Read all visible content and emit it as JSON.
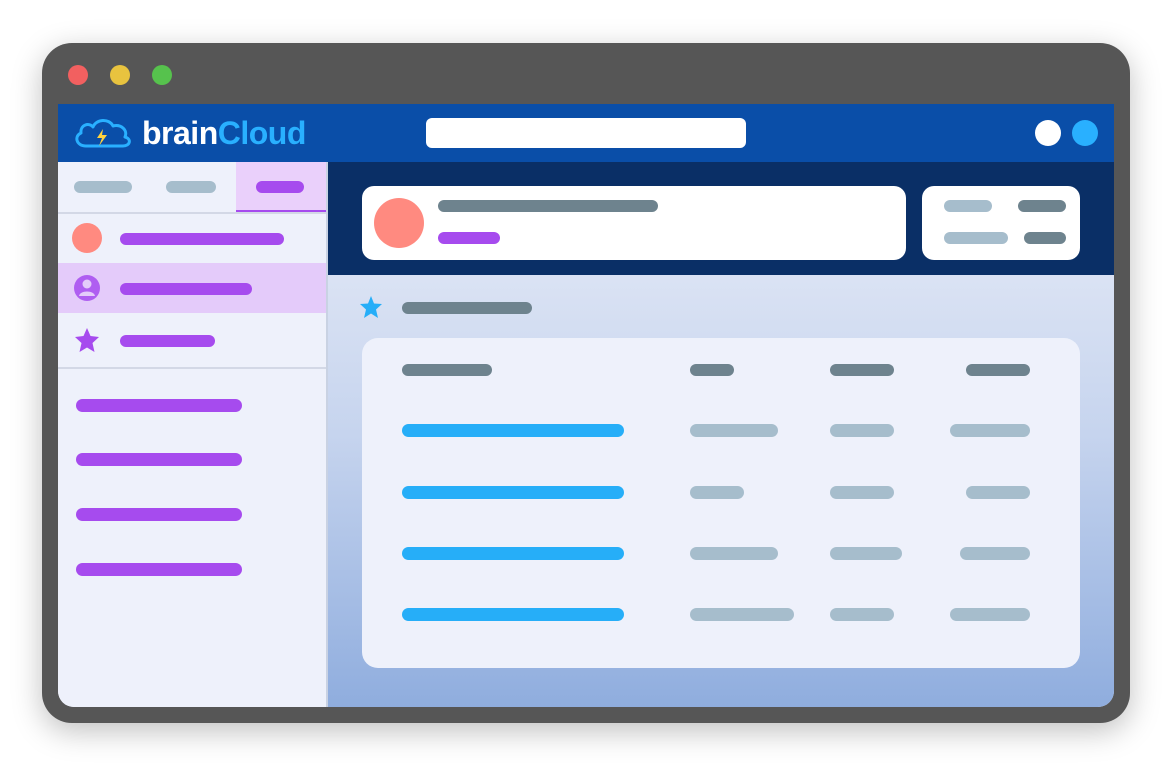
{
  "window": {
    "controls": [
      "close",
      "minimize",
      "maximize"
    ]
  },
  "app": {
    "brand": "brainCloud",
    "logo_icon": "cloud-lightning-icon"
  },
  "topbar": {
    "search_value": "",
    "actions": [
      "white-circle",
      "blue-circle"
    ]
  },
  "sidebar": {
    "tabs": [
      {
        "id": "tab-1",
        "active": false
      },
      {
        "id": "tab-2",
        "active": false
      },
      {
        "id": "tab-3",
        "active": true
      }
    ],
    "items": [
      {
        "icon": "avatar-dot-icon",
        "active": false
      },
      {
        "icon": "user-icon",
        "active": true
      },
      {
        "icon": "star-icon",
        "active": false
      }
    ],
    "links_count_visible": 4
  },
  "main": {
    "section_icon": "star-icon",
    "table": {
      "columns": 4,
      "rows": 4
    }
  },
  "colors": {
    "topbar": "#0a4ea8",
    "header": "#0a2f66",
    "accent_purple": "#a64bee",
    "accent_blue": "#26aef8",
    "avatar": "#ff8a80",
    "muted": "#a6bdcc",
    "dark_text": "#6e838e"
  }
}
